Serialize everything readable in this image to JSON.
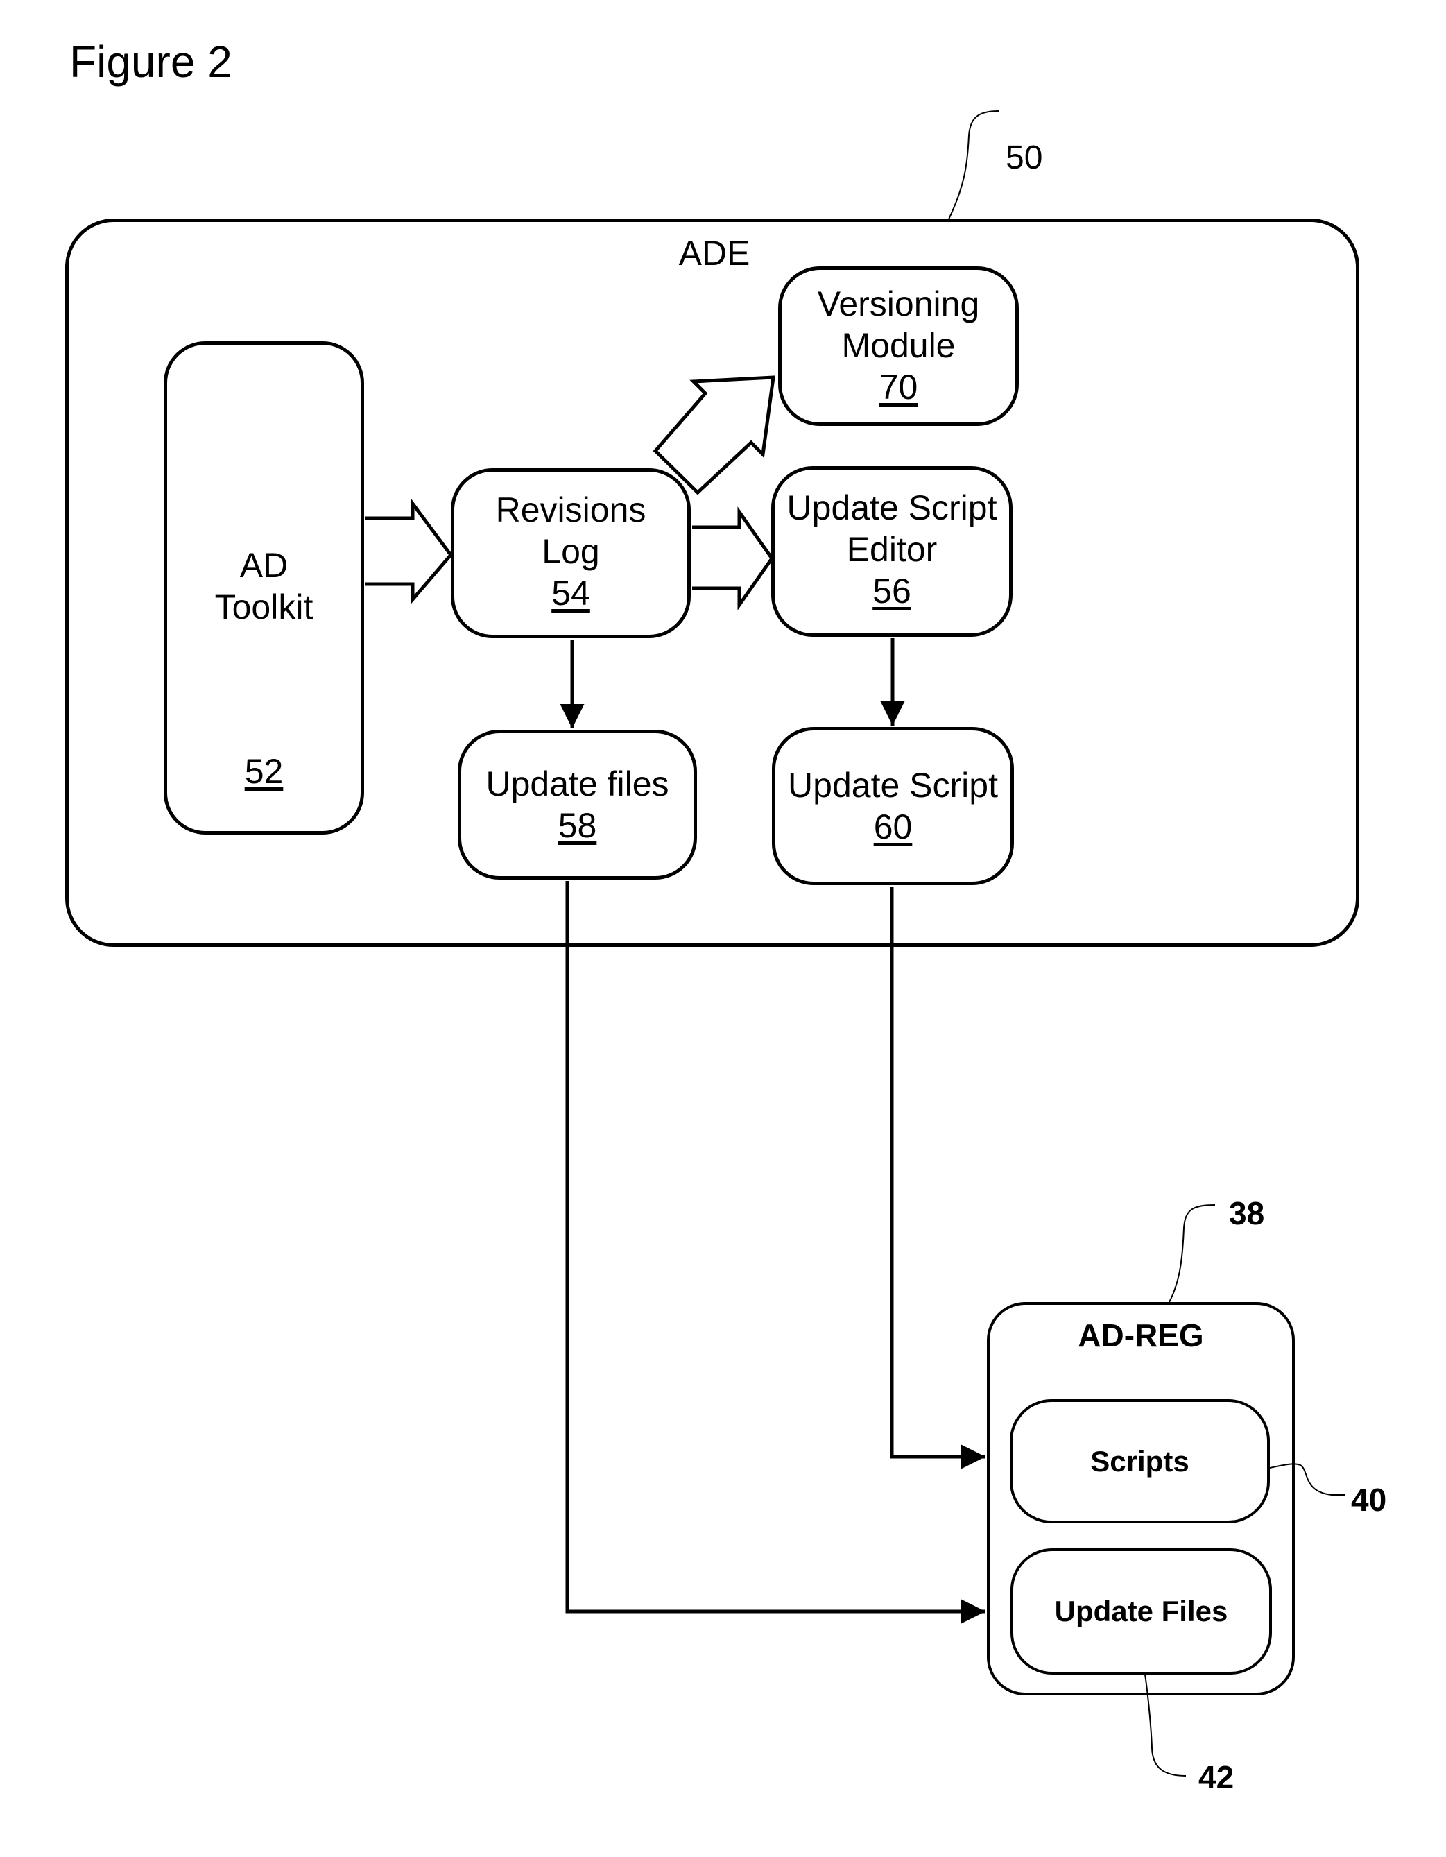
{
  "figure": {
    "title": "Figure 2"
  },
  "ade": {
    "label": "ADE",
    "ref": "50"
  },
  "nodes": {
    "ad_toolkit": {
      "line1": "AD",
      "line2": "Toolkit",
      "num": "52"
    },
    "revisions_log": {
      "line1": "Revisions",
      "line2": "Log",
      "num": "54"
    },
    "versioning_module": {
      "line1": "Versioning",
      "line2": "Module",
      "num": "70"
    },
    "update_script_editor": {
      "line1": "Update Script",
      "line2": "Editor",
      "num": "56"
    },
    "update_files": {
      "line1": "Update files",
      "num": "58"
    },
    "update_script": {
      "line1": "Update Script",
      "num": "60"
    }
  },
  "ad_reg": {
    "label": "AD-REG",
    "ref": "38",
    "scripts": {
      "label": "Scripts",
      "ref": "40"
    },
    "update_files": {
      "label": "Update Files",
      "ref": "42"
    }
  },
  "edges": [
    {
      "from": "AD Toolkit",
      "to": "Revisions Log",
      "style": "block-arrow"
    },
    {
      "from": "Revisions Log",
      "to": "Update Script Editor",
      "style": "block-arrow"
    },
    {
      "from": "Revisions Log",
      "to": "Versioning Module",
      "style": "block-arrow"
    },
    {
      "from": "Revisions Log",
      "to": "Update files",
      "style": "line-arrow"
    },
    {
      "from": "Update Script Editor",
      "to": "Update Script",
      "style": "line-arrow"
    },
    {
      "from": "Update Script",
      "to": "Scripts",
      "style": "line-arrow"
    },
    {
      "from": "Update files",
      "to": "Update Files",
      "style": "line-arrow"
    }
  ]
}
